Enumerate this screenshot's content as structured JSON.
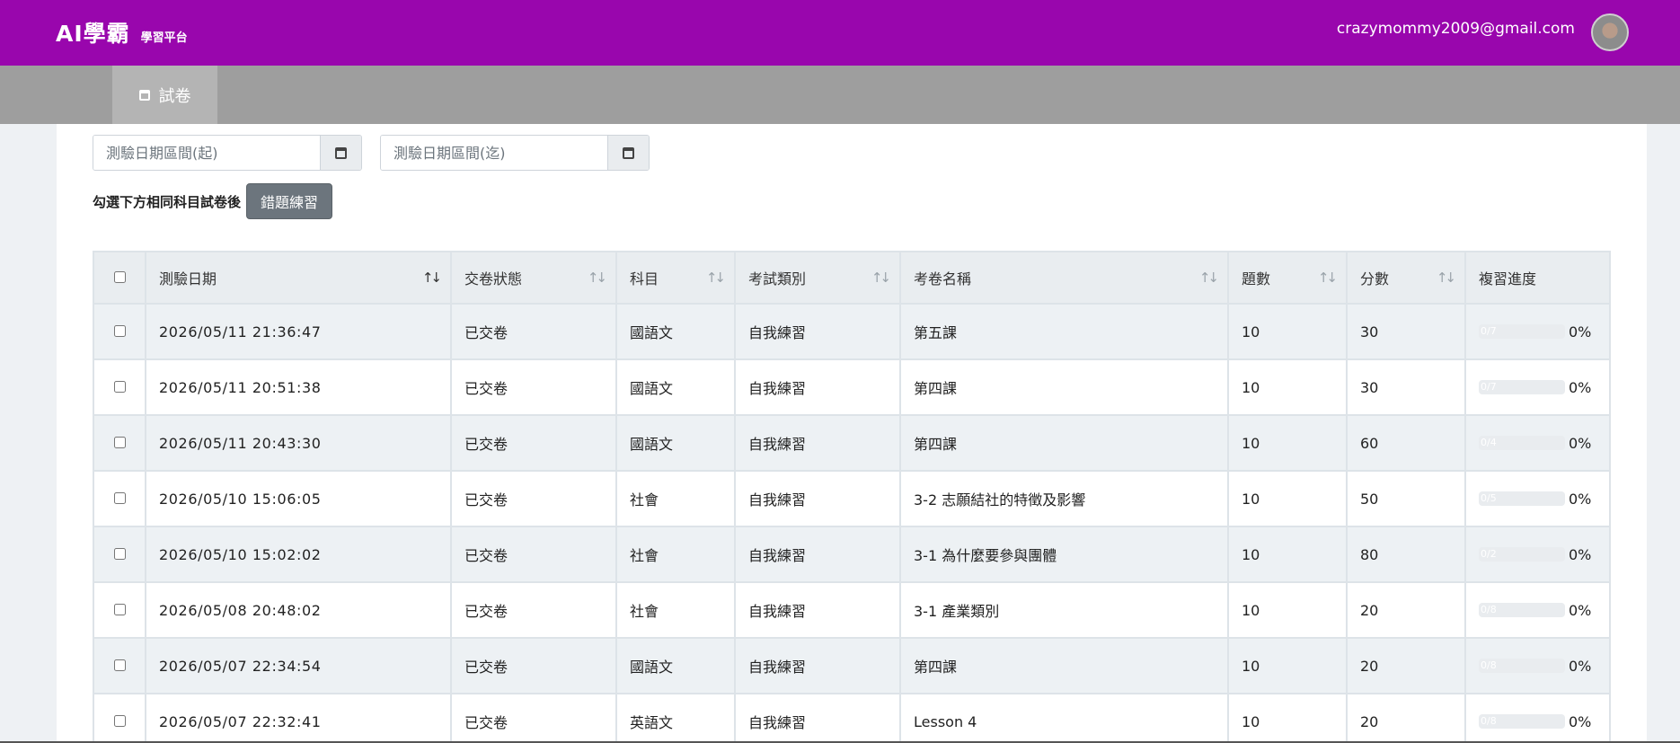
{
  "header": {
    "brand_title": "AI學霸",
    "brand_sub": "學習平台",
    "user_email": "crazymommy2009@gmail.com"
  },
  "nav": {
    "tab_label": "試卷"
  },
  "filters": {
    "date_from_placeholder": "測驗日期區間(起)",
    "date_to_placeholder": "測驗日期區間(迄)",
    "action_label": "勾選下方相同科目試卷後",
    "practice_button": "錯題練習"
  },
  "table": {
    "columns": [
      "測驗日期",
      "交卷狀態",
      "科目",
      "考試類別",
      "考卷名稱",
      "題數",
      "分數",
      "複習進度"
    ],
    "rows": [
      {
        "date": "2026/05/11 21:36:47",
        "status": "已交卷",
        "subject": "國語文",
        "category": "自我練習",
        "name": "第五課",
        "count": "10",
        "score": "30",
        "progress_label": "0/7",
        "progress_pct": "0%",
        "progress_value": 0
      },
      {
        "date": "2026/05/11 20:51:38",
        "status": "已交卷",
        "subject": "國語文",
        "category": "自我練習",
        "name": "第四課",
        "count": "10",
        "score": "30",
        "progress_label": "0/7",
        "progress_pct": "0%",
        "progress_value": 0
      },
      {
        "date": "2026/05/11 20:43:30",
        "status": "已交卷",
        "subject": "國語文",
        "category": "自我練習",
        "name": "第四課",
        "count": "10",
        "score": "60",
        "progress_label": "0/4",
        "progress_pct": "0%",
        "progress_value": 0
      },
      {
        "date": "2026/05/10 15:06:05",
        "status": "已交卷",
        "subject": "社會",
        "category": "自我練習",
        "name": "3-2 志願結社的特徵及影響",
        "count": "10",
        "score": "50",
        "progress_label": "0/5",
        "progress_pct": "0%",
        "progress_value": 0
      },
      {
        "date": "2026/05/10 15:02:02",
        "status": "已交卷",
        "subject": "社會",
        "category": "自我練習",
        "name": "3-1 為什麼要參與團體",
        "count": "10",
        "score": "80",
        "progress_label": "0/2",
        "progress_pct": "0%",
        "progress_value": 0
      },
      {
        "date": "2026/05/08 20:48:02",
        "status": "已交卷",
        "subject": "社會",
        "category": "自我練習",
        "name": "3-1 產業類別",
        "count": "10",
        "score": "20",
        "progress_label": "0/8",
        "progress_pct": "0%",
        "progress_value": 0
      },
      {
        "date": "2026/05/07 22:34:54",
        "status": "已交卷",
        "subject": "國語文",
        "category": "自我練習",
        "name": "第四課",
        "count": "10",
        "score": "20",
        "progress_label": "0/8",
        "progress_pct": "0%",
        "progress_value": 0
      },
      {
        "date": "2026/05/07 22:32:41",
        "status": "已交卷",
        "subject": "英語文",
        "category": "自我練習",
        "name": "Lesson 4",
        "count": "10",
        "score": "20",
        "progress_label": "0/8",
        "progress_pct": "0%",
        "progress_value": 0
      }
    ]
  },
  "colors": {
    "header_bg": "#9906ad",
    "nav_bg": "#9e9e9e",
    "button_bg": "#6c757d"
  }
}
